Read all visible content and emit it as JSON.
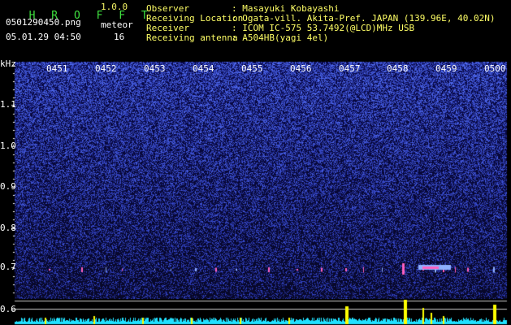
{
  "header": {
    "app_title": "H R O F F T",
    "app_version": "1.0.0",
    "filename": "0501290450.png",
    "datetime": "05.01.29 04:50",
    "meteor_label": "meteor",
    "meteor_count": "16",
    "info": [
      {
        "key": "Observer",
        "value": ": Masayuki Kobayashi"
      },
      {
        "key": "Receiving Location",
        "value": ": Ogata-vill. Akita-Pref. JAPAN (139.96E, 40.02N)"
      },
      {
        "key": "Receiver",
        "value": ": ICOM IC-575 53.7492(@LCD)MHz USB"
      },
      {
        "key": "Receiving antenna",
        "value": ": A504HB(yagi 4el)"
      }
    ]
  },
  "spectrogram": {
    "y_unit": "kHz",
    "y_ticks": [
      "1.1",
      "1.0",
      "0.9",
      "0.8",
      "0.7",
      "0.6"
    ],
    "time_ticks": [
      "0451",
      "0452",
      "0453",
      "0454",
      "0455",
      "0456",
      "0457",
      "0458",
      "0459",
      "0500"
    ],
    "colors": {
      "background": "#000000",
      "noise_dark": "#0c0c5a",
      "noise_bright": "#4c5cff",
      "echo": "#ff60c0",
      "bar": "#ffff00",
      "floor": "#20e0ff",
      "guide": "#c8c8c8"
    }
  }
}
